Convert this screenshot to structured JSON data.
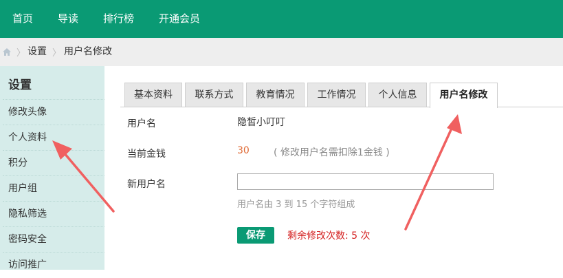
{
  "nav": {
    "items": [
      "首页",
      "导读",
      "排行榜",
      "开通会员"
    ]
  },
  "breadcrumb": {
    "items": [
      "设置",
      "用户名修改"
    ]
  },
  "sidebar": {
    "title": "设置",
    "items": [
      "修改头像",
      "个人资料",
      "积分",
      "用户组",
      "隐私筛选",
      "密码安全",
      "访问推广"
    ]
  },
  "tabs": [
    "基本资料",
    "联系方式",
    "教育情况",
    "工作情况",
    "个人信息",
    "用户名修改"
  ],
  "form": {
    "username_label": "用户名",
    "username_value": "隐皙小叮叮",
    "money_label": "当前金钱",
    "money_value": "30",
    "money_note": "( 修改用户名需扣除1金钱 )",
    "new_username_label": "新用户名",
    "new_username_value": "",
    "hint": "用户名由 3 到 15 个字符组成",
    "save_label": "保存",
    "remaining": "剩余修改次数: 5 次"
  },
  "colors": {
    "brand": "#0a9a74",
    "sidebar_bg": "#d6ecea",
    "annotation": "#f06060",
    "warn": "#d42020"
  },
  "icons": {
    "home": "home-icon",
    "arrows": "annotation-arrow"
  }
}
